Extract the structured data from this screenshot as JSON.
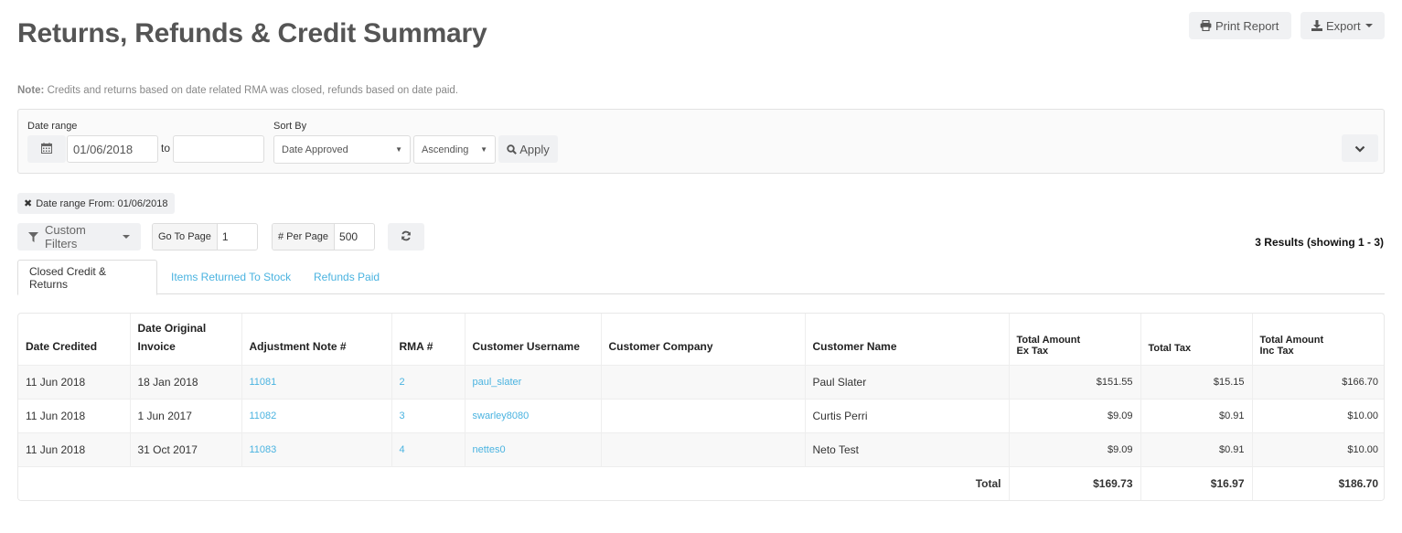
{
  "header": {
    "title": "Returns, Refunds & Credit Summary",
    "print_label": "Print Report",
    "export_label": "Export"
  },
  "note": {
    "prefix": "Note:",
    "text": " Credits and returns based on date related RMA was closed, refunds based on date paid."
  },
  "filters": {
    "date_range_label": "Date range",
    "date_from": "01/06/2018",
    "to_label": "to",
    "date_to": "",
    "sort_by_label": "Sort By",
    "sort_by_value": "Date Approved",
    "order_value": "Ascending",
    "apply_label": "Apply"
  },
  "active_filter_chip": "Date range From: 01/06/2018",
  "toolbar": {
    "custom_filters_label": "Custom Filters",
    "goto_page_label": "Go To Page",
    "goto_page_value": "1",
    "per_page_label": "# Per Page",
    "per_page_value": "500",
    "results_text": "3 Results (showing 1 - 3)"
  },
  "tabs": [
    {
      "label": "Closed Credit & Returns",
      "active": true
    },
    {
      "label": "Items Returned To Stock",
      "active": false
    },
    {
      "label": "Refunds Paid",
      "active": false
    }
  ],
  "table": {
    "headers": {
      "date_credited": "Date Credited",
      "date_original_invoice_1": "Date Original",
      "date_original_invoice_2": "Invoice",
      "adjustment_note": "Adjustment Note #",
      "rma": "RMA #",
      "customer_username": "Customer Username",
      "customer_company": "Customer Company",
      "customer_name": "Customer Name",
      "total_ex_tax_1": "Total Amount",
      "total_ex_tax_2": "Ex Tax",
      "total_tax": "Total Tax",
      "total_inc_tax_1": "Total Amount",
      "total_inc_tax_2": "Inc Tax"
    },
    "rows": [
      {
        "date_credited": "11 Jun 2018",
        "date_original_invoice": "18 Jan 2018",
        "adjustment_note": "11081",
        "rma": "2",
        "customer_username": "paul_slater",
        "customer_company": "",
        "customer_name": "Paul Slater",
        "total_ex_tax": "$151.55",
        "total_tax": "$15.15",
        "total_inc_tax": "$166.70"
      },
      {
        "date_credited": "11 Jun 2018",
        "date_original_invoice": "1 Jun 2017",
        "adjustment_note": "11082",
        "rma": "3",
        "customer_username": "swarley8080",
        "customer_company": "",
        "customer_name": "Curtis Perri",
        "total_ex_tax": "$9.09",
        "total_tax": "$0.91",
        "total_inc_tax": "$10.00"
      },
      {
        "date_credited": "11 Jun 2018",
        "date_original_invoice": "31 Oct 2017",
        "adjustment_note": "11083",
        "rma": "4",
        "customer_username": "nettes0",
        "customer_company": "",
        "customer_name": "Neto Test",
        "total_ex_tax": "$9.09",
        "total_tax": "$0.91",
        "total_inc_tax": "$10.00"
      }
    ],
    "totals": {
      "label": "Total",
      "total_ex_tax": "$169.73",
      "total_tax": "$16.97",
      "total_inc_tax": "$186.70"
    }
  },
  "colors": {
    "link": "#4ab3e0",
    "button_bg": "#f0f1f3",
    "title": "#555555"
  },
  "icons": {
    "print": "printer-icon",
    "export": "download-icon",
    "calendar": "calendar-icon",
    "search": "search-icon",
    "collapse": "chevron-down-icon",
    "remove": "close-icon",
    "filter": "filter-icon",
    "refresh": "refresh-icon"
  }
}
